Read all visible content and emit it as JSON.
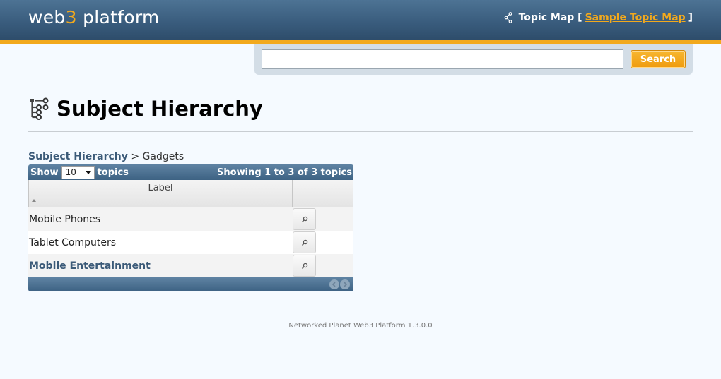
{
  "header": {
    "logo_prefix": "web",
    "logo_accent": "3",
    "logo_suffix": " platform",
    "topic_map_label": "Topic Map [",
    "topic_map_link": "Sample Topic Map",
    "topic_map_close": "]"
  },
  "search": {
    "value": "",
    "placeholder": "",
    "button_label": "Search"
  },
  "page": {
    "title": "Subject Hierarchy"
  },
  "breadcrumb": {
    "root": "Subject Hierarchy",
    "separator": ">",
    "current": "Gadgets"
  },
  "table": {
    "show_label": "Show",
    "page_size": "10",
    "topics_label": "topics",
    "info": "Showing 1 to 3 of 3 topics",
    "columns": [
      "Label",
      ""
    ],
    "rows": [
      {
        "label": "Mobile Phones"
      },
      {
        "label": "Tablet Computers"
      },
      {
        "label": "Mobile Entertainment"
      }
    ]
  },
  "footer": {
    "text": "Networked Planet Web3 Platform 1.3.0.0"
  },
  "colors": {
    "header_blue": "#3a5d7e",
    "accent_orange": "#f2a91d",
    "link_blue": "#3b5a78"
  }
}
